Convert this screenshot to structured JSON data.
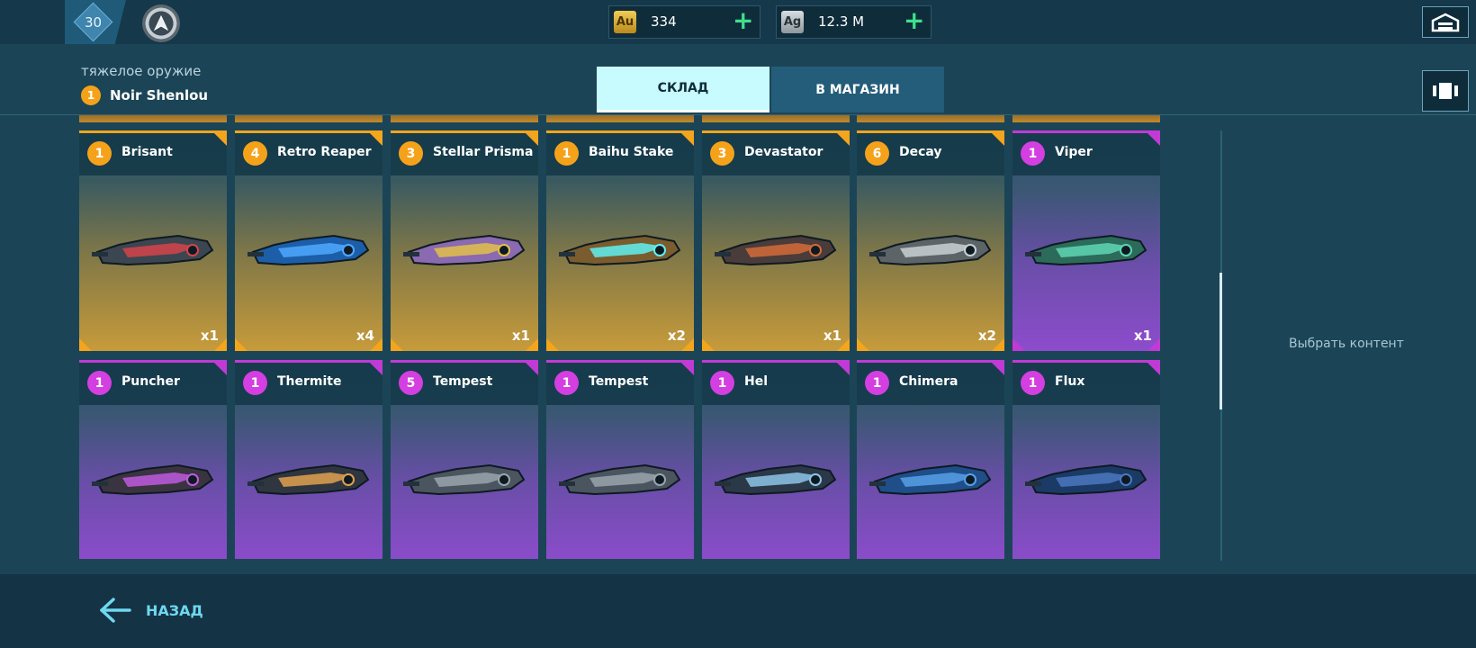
{
  "topbar": {
    "level": "30",
    "currencies": [
      {
        "code": "Au",
        "value": "334"
      },
      {
        "code": "Ag",
        "value": "12.3 M"
      }
    ]
  },
  "header": {
    "category": "тяжелое оружие",
    "owner_rank": "1",
    "owner_name": "Noir Shenlou",
    "tabs": [
      "СКЛАД",
      "В МАГАЗИН"
    ],
    "active_tab": "СКЛАД"
  },
  "weapons": [
    {
      "rank": "1",
      "name": "Brisant",
      "qty": "x1",
      "rarity": "gold",
      "icon": "heavy-rifle-icon"
    },
    {
      "rank": "4",
      "name": "Retro Reaper",
      "qty": "x4",
      "rarity": "gold",
      "icon": "blue-rifle-icon"
    },
    {
      "rank": "3",
      "name": "Stellar Prisma",
      "qty": "x1",
      "rarity": "gold",
      "icon": "prisma-gun-icon"
    },
    {
      "rank": "1",
      "name": "Baihu Stake",
      "qty": "x2",
      "rarity": "gold",
      "icon": "stake-lance-icon"
    },
    {
      "rank": "3",
      "name": "Devastator",
      "qty": "x1",
      "rarity": "gold",
      "icon": "cannon-icon"
    },
    {
      "rank": "6",
      "name": "Decay",
      "qty": "x2",
      "rarity": "gold",
      "icon": "launcher-icon"
    },
    {
      "rank": "1",
      "name": "Viper",
      "qty": "x1",
      "rarity": "purple",
      "icon": "gatling-icon"
    },
    {
      "rank": "1",
      "name": "Puncher",
      "qty": "",
      "rarity": "purple",
      "icon": "puncher-cannon-icon"
    },
    {
      "rank": "1",
      "name": "Thermite",
      "qty": "",
      "rarity": "purple",
      "icon": "thermite-launcher-icon"
    },
    {
      "rank": "5",
      "name": "Tempest",
      "qty": "",
      "rarity": "purple",
      "icon": "twin-barrel-icon"
    },
    {
      "rank": "1",
      "name": "Tempest",
      "qty": "",
      "rarity": "purple",
      "icon": "twin-barrel-icon"
    },
    {
      "rank": "1",
      "name": "Hel",
      "qty": "",
      "rarity": "purple",
      "icon": "hel-cannon-icon"
    },
    {
      "rank": "1",
      "name": "Chimera",
      "qty": "",
      "rarity": "purple",
      "icon": "chimera-gun-icon"
    },
    {
      "rank": "1",
      "name": "Flux",
      "qty": "",
      "rarity": "purple",
      "icon": "flux-rifle-icon"
    }
  ],
  "side_panel": {
    "placeholder": "Выбрать контент"
  },
  "footer": {
    "back_label": "НАЗАД"
  },
  "colors": {
    "gold": "#f4a51c",
    "purple": "#c23ad6",
    "tab_active": "#c8fbfd",
    "back": "#6fd8f0"
  }
}
